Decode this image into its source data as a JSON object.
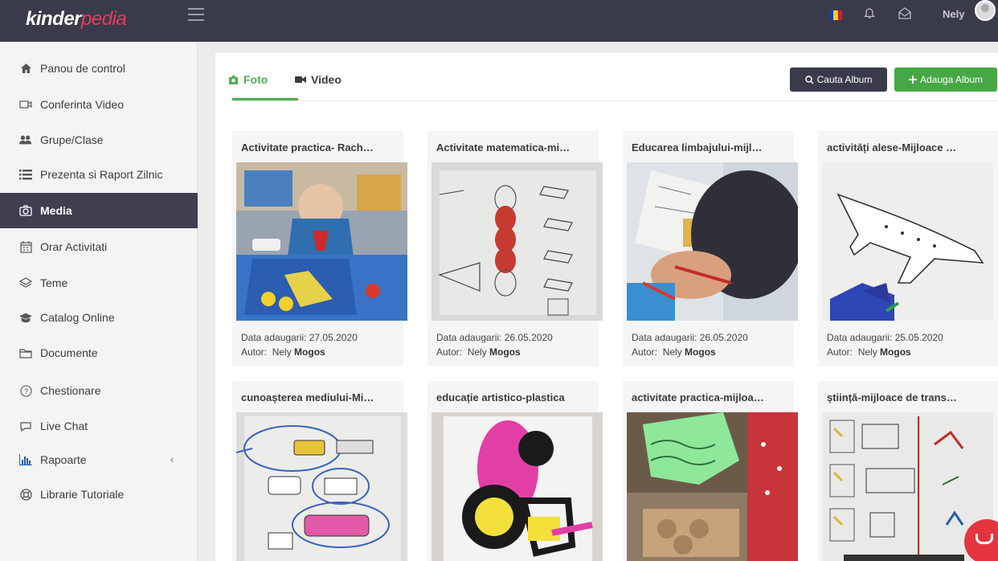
{
  "app": {
    "logo_part1": "kinder",
    "logo_part2": "pedia",
    "user_name": "Nely",
    "accent_color": "#4caf50",
    "brand_dark": "#3a3b4a",
    "brand_red": "#e63b59"
  },
  "sidebar": {
    "items": [
      {
        "label": "Panou de control",
        "icon": "home-icon"
      },
      {
        "label": "Conferinta Video",
        "icon": "video-camera-icon"
      },
      {
        "label": "Grupe/Clase",
        "icon": "group-icon"
      },
      {
        "label": "Prezenta si Raport Zilnic",
        "icon": "list-icon"
      },
      {
        "label": "Media",
        "icon": "camera-icon",
        "active": true
      },
      {
        "label": "Orar Activitati",
        "icon": "calendar-icon"
      },
      {
        "label": "Teme",
        "icon": "layers-icon"
      },
      {
        "label": "Catalog Online",
        "icon": "graduation-cap-icon"
      },
      {
        "label": "Documente",
        "icon": "folder-icon"
      },
      {
        "label": "Chestionare",
        "icon": "question-circle-icon"
      },
      {
        "label": "Live Chat",
        "icon": "chat-icon"
      },
      {
        "label": "Rapoarte",
        "icon": "bar-chart-icon"
      },
      {
        "label": "Librarie Tutoriale",
        "icon": "life-ring-icon"
      }
    ]
  },
  "main": {
    "tabs": [
      {
        "label": "Foto",
        "icon": "camera-icon",
        "active": true
      },
      {
        "label": "Video",
        "icon": "video-icon"
      }
    ],
    "search_button": "Cauta Album",
    "add_button": "Adauga Album",
    "date_label": "Data adaugarii:",
    "author_label": "Autor:",
    "albums": [
      {
        "title": "Activitate practica- Rach…",
        "date": "27.05.2020",
        "author_first": "Nely",
        "author_last": "Mogos"
      },
      {
        "title": "Activitate matematica-mi…",
        "date": "26.05.2020",
        "author_first": "Nely",
        "author_last": "Mogos"
      },
      {
        "title": "Educarea limbajului-mijl…",
        "date": "26.05.2020",
        "author_first": "Nely",
        "author_last": "Mogos"
      },
      {
        "title": "activități alese-Mijloace …",
        "date": "25.05.2020",
        "author_first": "Nely",
        "author_last": "Mogos"
      },
      {
        "title": "cunoașterea mediului-Mi…",
        "date": "",
        "author_first": "",
        "author_last": ""
      },
      {
        "title": "educație artistico-plastica",
        "date": "",
        "author_first": "",
        "author_last": ""
      },
      {
        "title": "activitate practica-mijloa…",
        "date": "",
        "author_first": "",
        "author_last": ""
      },
      {
        "title": "știință-mijloace de trans…",
        "date": "",
        "author_first": "",
        "author_last": ""
      }
    ]
  }
}
